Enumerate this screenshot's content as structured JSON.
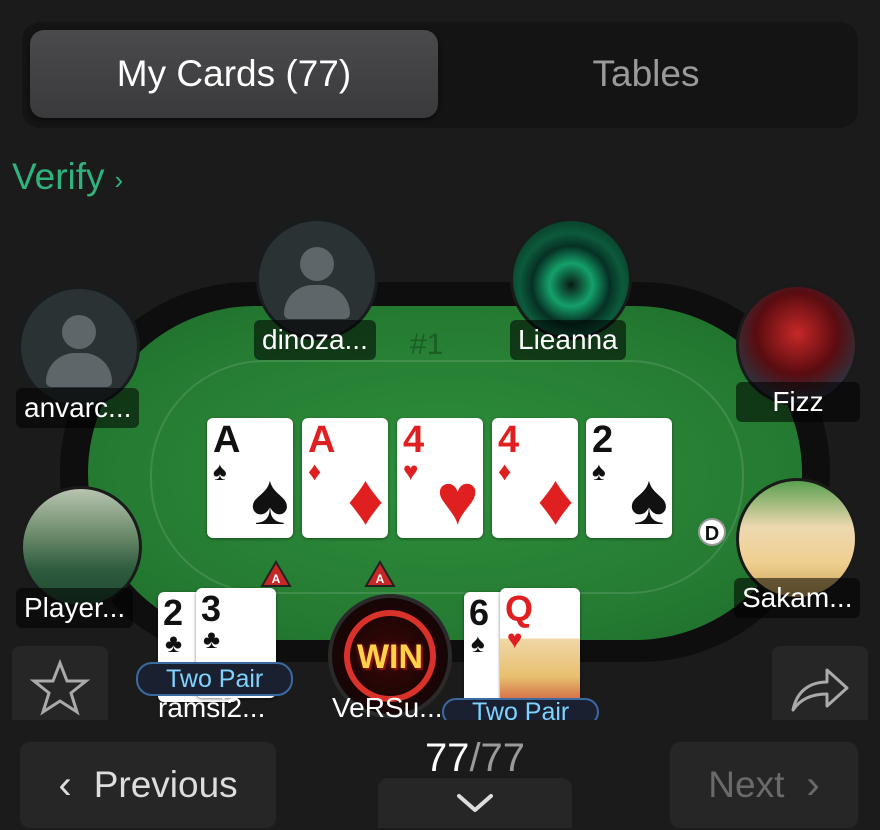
{
  "tabs": {
    "my_cards": "My Cards (77)",
    "tables": "Tables"
  },
  "verify": {
    "label": "Verify",
    "chevron": "›"
  },
  "table": {
    "number": "#1"
  },
  "board_cards": [
    {
      "rank": "A",
      "suit": "♠",
      "color": "black"
    },
    {
      "rank": "A",
      "suit": "♦",
      "color": "red"
    },
    {
      "rank": "4",
      "suit": "♥",
      "color": "red"
    },
    {
      "rank": "4",
      "suit": "♦",
      "color": "red"
    },
    {
      "rank": "2",
      "suit": "♠",
      "color": "black"
    }
  ],
  "players": {
    "dinoza": "dinoza...",
    "lieanna": "Lieanna",
    "anvarc": "anvarc...",
    "fizz": "Fizz",
    "player": "Player...",
    "sakam": "Sakam...",
    "ramsi": "ramsi2...",
    "versu": "VeRSu..."
  },
  "dealer_button": "D",
  "allin_marker": "A",
  "ramsi_hand": {
    "cards": [
      {
        "rank": "2",
        "suit": "♣"
      },
      {
        "rank": "3",
        "suit": "♣"
      }
    ],
    "label": "Two Pair"
  },
  "versu_hand": {
    "cards": [
      {
        "rank": "6",
        "suit": "♠"
      },
      {
        "rank": "Q",
        "suit": "♥"
      }
    ],
    "label": "Two Pair"
  },
  "win_badge": "WIN",
  "icons": {
    "favorite": "star-icon",
    "share": "share-icon"
  },
  "navigation": {
    "previous": "Previous",
    "next": "Next",
    "current": "77",
    "total": "/77",
    "expand": "chevron-down-icon"
  },
  "colors": {
    "accent": "#2fb37d",
    "felt": "#247a31",
    "hand_label": "#7fd3ff"
  }
}
